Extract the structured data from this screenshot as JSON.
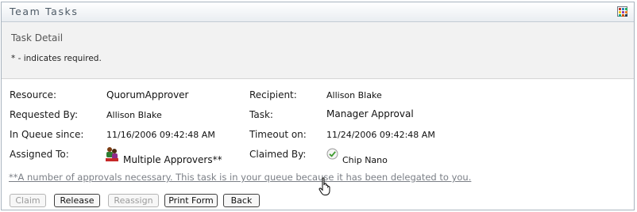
{
  "panel": {
    "title": "Team Tasks",
    "menu_icon": "grid-menu-icon"
  },
  "header": {
    "title": "Task Detail",
    "required_note": "* - indicates required."
  },
  "fields": {
    "resource_label": "Resource:",
    "resource_value": "QuorumApprover",
    "requested_by_label": "Requested By:",
    "requested_by_value": "Allison Blake",
    "in_queue_label": "In Queue since:",
    "in_queue_value": "11/16/2006 09:42:48 AM",
    "assigned_to_label": "Assigned To:",
    "assigned_to_value": "Multiple Approvers**",
    "recipient_label": "Recipient:",
    "recipient_value": "Allison Blake",
    "task_label": "Task:",
    "task_value": "Manager Approval",
    "timeout_label": "Timeout on:",
    "timeout_value": "11/24/2006 09:42:48 AM",
    "claimed_by_label": "Claimed By:",
    "claimed_by_value": "Chip Nano"
  },
  "note": "**A number of approvals necessary. This task is in your queue because it has been delegated to you.",
  "buttons": {
    "claim": "Claim",
    "release": "Release",
    "reassign": "Reassign",
    "print_form": "Print Form",
    "back": "Back"
  },
  "colors": {
    "title_text": "#4d5a66",
    "header_bg": "#f2f2f2",
    "note_text": "#7b7f86",
    "border": "#a9b4bf"
  }
}
